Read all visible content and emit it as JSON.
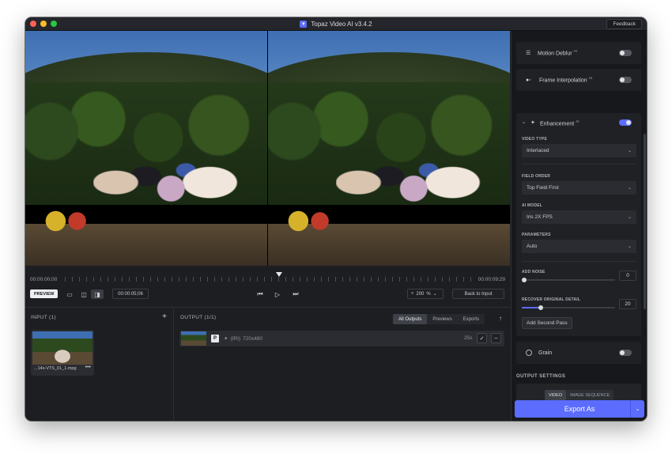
{
  "app": {
    "title": "Topaz Video AI  v3.4.2",
    "feedback_label": "Feedback"
  },
  "timeline": {
    "start_timecode": "00:00:00;00",
    "end_timecode": "00:00:09;29",
    "current_time": "00:00:05;06",
    "preview_label": "PREVIEW",
    "zoom_value": "200",
    "zoom_unit": "%",
    "back_to_input_label": "Back to Input",
    "playhead_position": 0.52
  },
  "input_panel": {
    "title": "INPUT (1)",
    "add_icon": "+",
    "file_name": "...14s-VTS_01_1.mpg",
    "more_icon": "•••"
  },
  "output_panel": {
    "title": "OUTPUT (1/1)",
    "tabs": [
      {
        "label": "All Outputs",
        "active": true
      },
      {
        "label": "Previews",
        "active": false
      },
      {
        "label": "Exports",
        "active": false
      }
    ],
    "row": {
      "badge": "P",
      "model": "(IRI)",
      "resolution": "720x480",
      "duration": "25s"
    }
  },
  "sidebar": {
    "motion_deblur": {
      "label": "Motion Deblur",
      "ai": "AI",
      "enabled": false
    },
    "frame_interpolation": {
      "label": "Frame Interpolation",
      "ai": "AI",
      "enabled": false
    },
    "enhancement": {
      "label": "Enhancement",
      "ai": "AI",
      "enabled": true,
      "video_type_label": "VIDEO TYPE",
      "video_type_value": "Interlaced",
      "field_order_label": "FIELD ORDER",
      "field_order_value": "Top Field First",
      "ai_model_label": "AI MODEL",
      "ai_model_value": "Iris 2X FPS",
      "parameters_label": "PARAMETERS",
      "parameters_value": "Auto",
      "add_noise_label": "ADD NOISE",
      "add_noise_value": "0",
      "recover_detail_label": "RECOVER ORIGINAL DETAIL",
      "recover_detail_value": "20",
      "add_second_pass_label": "Add Second Pass"
    },
    "grain": {
      "label": "Grain",
      "enabled": false
    },
    "output_settings": {
      "title": "OUTPUT SETTINGS",
      "video_label": "VIDEO",
      "image_sequence_label": "IMAGE SEQUENCE"
    },
    "export_label": "Export As"
  },
  "colors": {
    "accent": "#5b6cff",
    "background": "#1c1e22",
    "sidebar": "#16181b"
  }
}
